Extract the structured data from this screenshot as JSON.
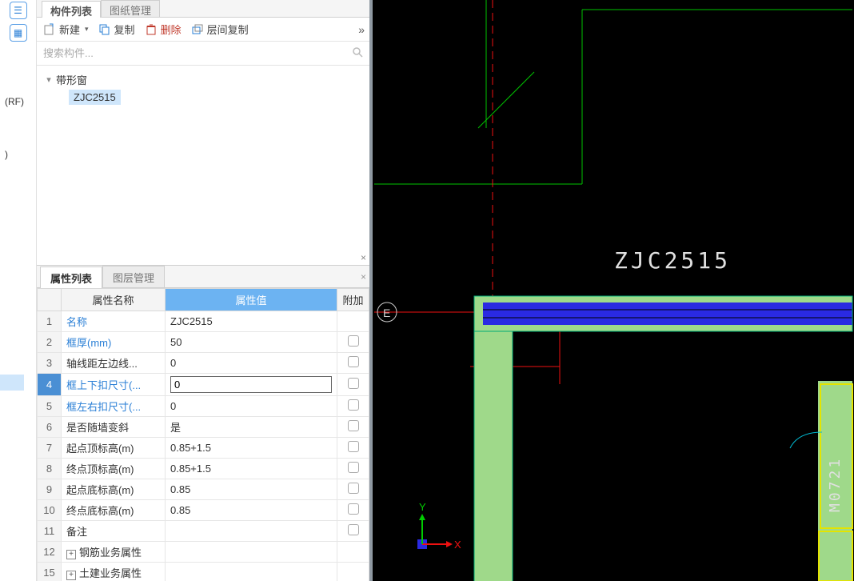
{
  "sidestrip": {
    "icon1": "☰",
    "icon2": "▦",
    "label_rf": "(RF)",
    "label_paren": ")"
  },
  "topTabs": {
    "active": "构件列表",
    "inactive": "图纸管理"
  },
  "toolbar": {
    "newLabel": "新建",
    "copyLabel": "复制",
    "deleteLabel": "删除",
    "floorCopyLabel": "层间复制",
    "more": "»"
  },
  "search": {
    "placeholder": "搜索构件..."
  },
  "tree": {
    "root": "带形窗",
    "child": "ZJC2515"
  },
  "propTabs": {
    "active": "属性列表",
    "inactive": "图层管理"
  },
  "propHeader": {
    "name": "属性名称",
    "value": "属性值",
    "extra": "附加"
  },
  "props": [
    {
      "n": "1",
      "name": "名称",
      "link": true,
      "value": "ZJC2515",
      "chk": false
    },
    {
      "n": "2",
      "name": "框厚(mm)",
      "link": true,
      "value": "50",
      "chk": true
    },
    {
      "n": "3",
      "name": "轴线距左边线...",
      "link": false,
      "value": "0",
      "chk": true
    },
    {
      "n": "4",
      "name": "框上下扣尺寸(...",
      "link": true,
      "value": "0",
      "chk": true,
      "editing": true,
      "sel": true
    },
    {
      "n": "5",
      "name": "框左右扣尺寸(...",
      "link": true,
      "value": "0",
      "chk": true
    },
    {
      "n": "6",
      "name": "是否随墙变斜",
      "link": false,
      "value": "是",
      "chk": true
    },
    {
      "n": "7",
      "name": "起点顶标高(m)",
      "link": false,
      "value": "0.85+1.5",
      "chk": true
    },
    {
      "n": "8",
      "name": "终点顶标高(m)",
      "link": false,
      "value": "0.85+1.5",
      "chk": true
    },
    {
      "n": "9",
      "name": "起点底标高(m)",
      "link": false,
      "value": "0.85",
      "chk": true
    },
    {
      "n": "10",
      "name": "终点底标高(m)",
      "link": false,
      "value": "0.85",
      "chk": true
    },
    {
      "n": "11",
      "name": "备注",
      "link": false,
      "value": "",
      "chk": true
    },
    {
      "n": "12",
      "name": "钢筋业务属性",
      "link": false,
      "value": "",
      "chk": false,
      "expand": true
    },
    {
      "n": "15",
      "name": "土建业务属性",
      "link": false,
      "value": "",
      "chk": false,
      "expand": true
    }
  ],
  "viewport": {
    "componentLabel": "ZJC2515",
    "axisMark": "E",
    "doorLabel": "M0721",
    "ucs": {
      "x": "X",
      "y": "Y"
    }
  }
}
